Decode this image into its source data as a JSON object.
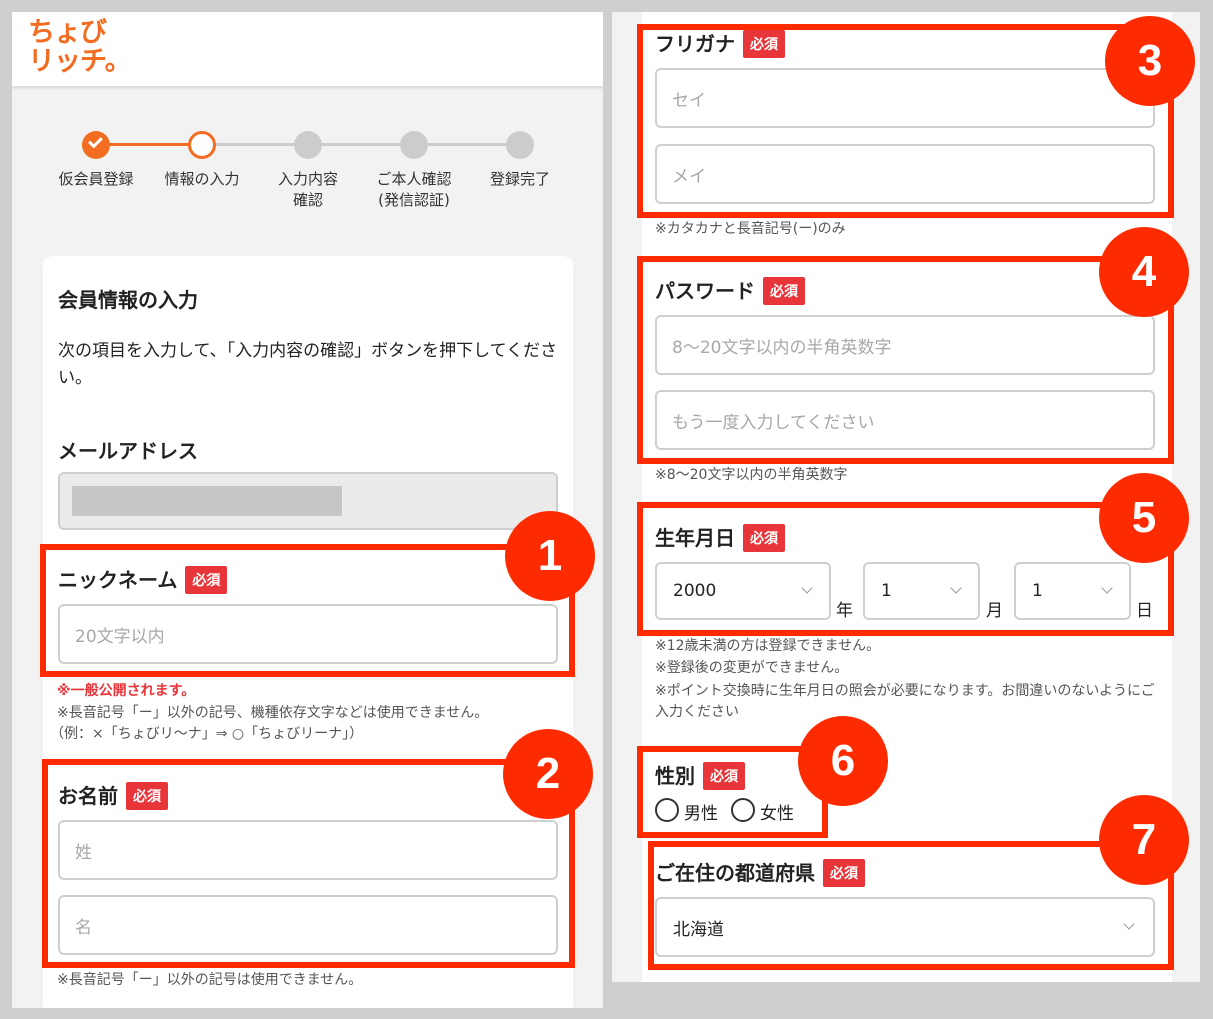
{
  "logo": {
    "line1": "ちょび",
    "line2": "リッチ。"
  },
  "steps": [
    {
      "label": "仮会員登録",
      "state": "done"
    },
    {
      "label": "情報の入力",
      "state": "current"
    },
    {
      "label": "入力内容\n確認",
      "state": "pending"
    },
    {
      "label": "ご本人確認\n(発信認証)",
      "state": "pending"
    },
    {
      "label": "登録完了",
      "state": "pending"
    }
  ],
  "form": {
    "title": "会員情報の入力",
    "description": "次の項目を入力して、「入力内容の確認」ボタンを押下してください。",
    "required_label": "必須",
    "email": {
      "label": "メールアドレス"
    },
    "nickname": {
      "label": "ニックネーム",
      "placeholder": "20文字以内",
      "note_public": "※一般公開されます。",
      "note_1": "※長音記号「ー」以外の記号、機種依存文字などは使用できません。",
      "note_2": "（例：×「ちょびリ〜ナ」⇒ ○「ちょびリーナ」）"
    },
    "name": {
      "label": "お名前",
      "last_placeholder": "姓",
      "first_placeholder": "名",
      "note": "※長音記号「ー」以外の記号は使用できません。"
    },
    "furigana": {
      "label": "フリガナ",
      "last_placeholder": "セイ",
      "first_placeholder": "メイ",
      "note": "※カタカナと長音記号(ー)のみ"
    },
    "password": {
      "label": "パスワード",
      "placeholder": "8〜20文字以内の半角英数字",
      "confirm_placeholder": "もう一度入力してください",
      "note": "※8〜20文字以内の半角英数字"
    },
    "birthday": {
      "label": "生年月日",
      "year": "2000",
      "year_unit": "年",
      "month": "1",
      "month_unit": "月",
      "day": "1",
      "day_unit": "日",
      "note_1": "※12歳未満の方は登録できません。",
      "note_2": "※登録後の変更ができません。",
      "note_3": "※ポイント交換時に生年月日の照会が必要になります。お間違いのないようにご入力ください"
    },
    "gender": {
      "label": "性別",
      "male": "男性",
      "female": "女性"
    },
    "prefecture": {
      "label": "ご在住の都道府県",
      "value": "北海道"
    }
  },
  "badges": [
    "1",
    "2",
    "3",
    "4",
    "5",
    "6",
    "7"
  ],
  "colors": {
    "brand": "#f26d21",
    "required": "#e8353a",
    "highlight": "#ff2b00"
  }
}
